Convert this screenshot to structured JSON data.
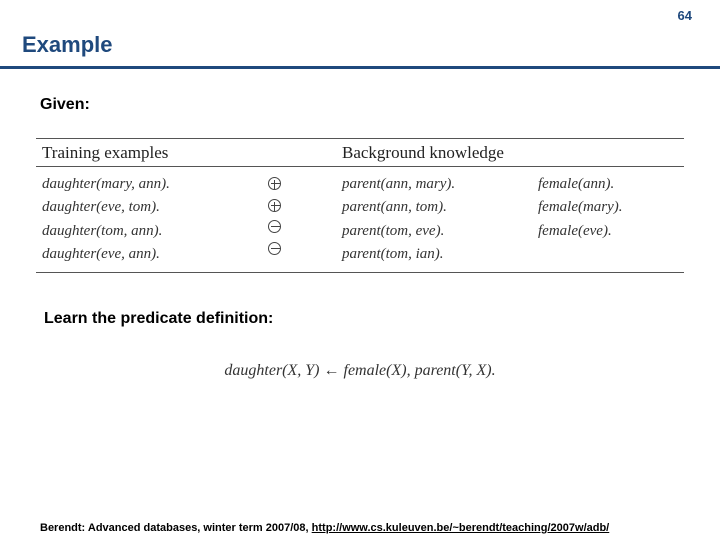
{
  "page_number": "64",
  "title": "Example",
  "given_label": "Given:",
  "table": {
    "head_left": "Training examples",
    "head_right": "Background knowledge",
    "training": [
      "daughter(mary, ann).",
      "daughter(eve, tom).",
      "daughter(tom, ann).",
      "daughter(eve, ann)."
    ],
    "labels": [
      "plus",
      "plus",
      "minus",
      "minus"
    ],
    "bg_col1": [
      "parent(ann, mary).",
      "parent(ann, tom).",
      "parent(tom, eve).",
      "parent(tom, ian)."
    ],
    "bg_col2": [
      "female(ann).",
      "female(mary).",
      "female(eve).",
      ""
    ]
  },
  "learn_label": "Learn the predicate definition:",
  "definition": "daughter(X, Y) ← female(X), parent(Y, X).",
  "footer_prefix": "Berendt: Advanced databases, winter term 2007/08, ",
  "footer_link": "http://www.cs.kuleuven.be/~berendt/teaching/2007w/adb/"
}
